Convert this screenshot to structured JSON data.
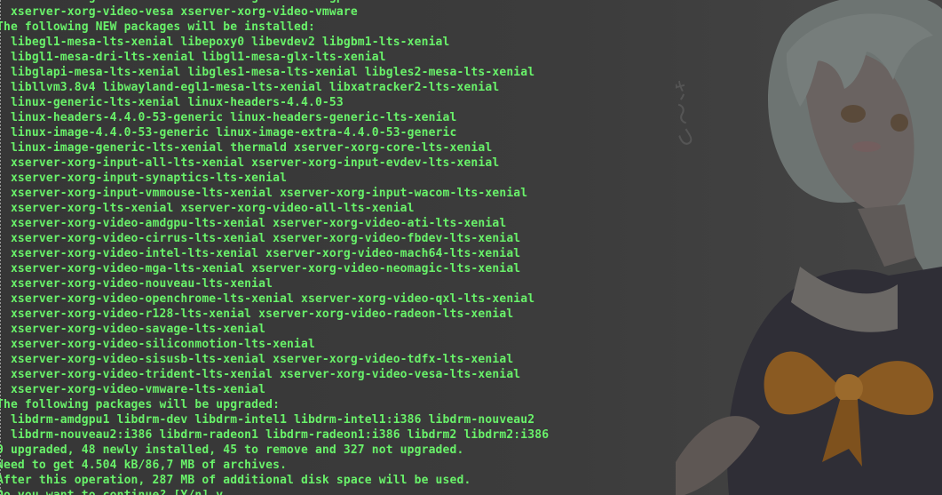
{
  "terminal": {
    "text_color": "#69f26a",
    "lines": [
      "  xserver-xorg-video-all xserver-xorg-video-amdgpu",
      "  xserver-xorg-video-vesa xserver-xorg-video-vmware",
      "The following NEW packages will be installed:",
      "  libegl1-mesa-lts-xenial libepoxy0 libevdev2 libgbm1-lts-xenial",
      "  libgl1-mesa-dri-lts-xenial libgl1-mesa-glx-lts-xenial",
      "  libglapi-mesa-lts-xenial libgles1-mesa-lts-xenial libgles2-mesa-lts-xenial",
      "  libllvm3.8v4 libwayland-egl1-mesa-lts-xenial libxatracker2-lts-xenial",
      "  linux-generic-lts-xenial linux-headers-4.4.0-53",
      "  linux-headers-4.4.0-53-generic linux-headers-generic-lts-xenial",
      "  linux-image-4.4.0-53-generic linux-image-extra-4.4.0-53-generic",
      "  linux-image-generic-lts-xenial thermald xserver-xorg-core-lts-xenial",
      "  xserver-xorg-input-all-lts-xenial xserver-xorg-input-evdev-lts-xenial",
      "  xserver-xorg-input-synaptics-lts-xenial",
      "  xserver-xorg-input-vmmouse-lts-xenial xserver-xorg-input-wacom-lts-xenial",
      "  xserver-xorg-lts-xenial xserver-xorg-video-all-lts-xenial",
      "  xserver-xorg-video-amdgpu-lts-xenial xserver-xorg-video-ati-lts-xenial",
      "  xserver-xorg-video-cirrus-lts-xenial xserver-xorg-video-fbdev-lts-xenial",
      "  xserver-xorg-video-intel-lts-xenial xserver-xorg-video-mach64-lts-xenial",
      "  xserver-xorg-video-mga-lts-xenial xserver-xorg-video-neomagic-lts-xenial",
      "  xserver-xorg-video-nouveau-lts-xenial",
      "  xserver-xorg-video-openchrome-lts-xenial xserver-xorg-video-qxl-lts-xenial",
      "  xserver-xorg-video-r128-lts-xenial xserver-xorg-video-radeon-lts-xenial",
      "  xserver-xorg-video-savage-lts-xenial",
      "  xserver-xorg-video-siliconmotion-lts-xenial",
      "  xserver-xorg-video-sisusb-lts-xenial xserver-xorg-video-tdfx-lts-xenial",
      "  xserver-xorg-video-trident-lts-xenial xserver-xorg-video-vesa-lts-xenial",
      "  xserver-xorg-video-vmware-lts-xenial",
      "The following packages will be upgraded:",
      "  libdrm-amdgpu1 libdrm-dev libdrm-intel1 libdrm-intel1:i386 libdrm-nouveau2",
      "  libdrm-nouveau2:i386 libdrm-radeon1 libdrm-radeon1:i386 libdrm2 libdrm2:i386",
      "0 upgraded, 48 newly installed, 45 to remove and 327 not upgraded.",
      "Need to get 4.504 kB/86,7 MB of archives.",
      "After this operation, 287 MB of additional disk space will be used.",
      "Do you want to continue? [Y/n] y"
    ]
  },
  "wallpaper": {
    "description_icon": "anime-girl-wallpaper",
    "handwriting": "む〜っ"
  }
}
